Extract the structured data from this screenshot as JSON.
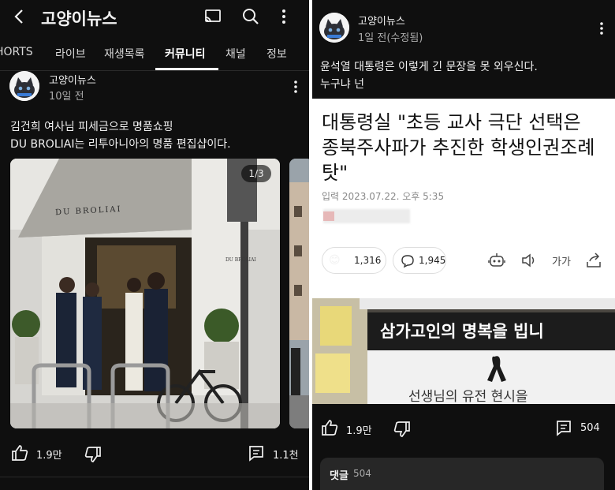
{
  "left": {
    "header": {
      "title": "고양이뉴스"
    },
    "tabs": [
      "HORTS",
      "라이브",
      "재생목록",
      "커뮤니티",
      "채널",
      "정보"
    ],
    "post": {
      "channel": "고양이뉴스",
      "time": "10일 전",
      "text_line1": "김건희 여사님 피세금으로 명품쇼핑",
      "text_line2": "DU BROLIAI는 리투아니아의 명품 편집샵이다.",
      "image_counter": "1/3",
      "awning_text": "DU BROLIAI",
      "wall_sign": "DU BROLIAI",
      "likes": "1.9만",
      "comments": "1.1천"
    }
  },
  "right": {
    "post": {
      "channel": "고양이뉴스",
      "time": "1일 전(수정됨)",
      "text_line1": "윤석열 대통령은 이렇게 긴 문장을 못 외우신다.",
      "text_line2": "누구냐 넌",
      "article": {
        "headline_line1": "대통령실 \"초등 교사 극단 선택은",
        "headline_line2": "종북주사파가 추진한 학생인권조례",
        "headline_line3": "탓\"",
        "date": "입력 2023.07.22. 오후 5:35",
        "reaction_count": "1,316",
        "comment_count": "1,945",
        "font_size_label": "가가",
        "banner_text": "삼가고인의 명복을 빕니",
        "banner_subtext": "선생님의 유전 현시을"
      },
      "likes": "1.9만",
      "comments": "504",
      "comment_section_label": "댓글",
      "comment_section_count": "504"
    }
  },
  "colors": {
    "background": "#0f0f0f",
    "text": "#f1f1f1",
    "muted": "#aaaaaa",
    "tab_underline": "#ffffff"
  }
}
